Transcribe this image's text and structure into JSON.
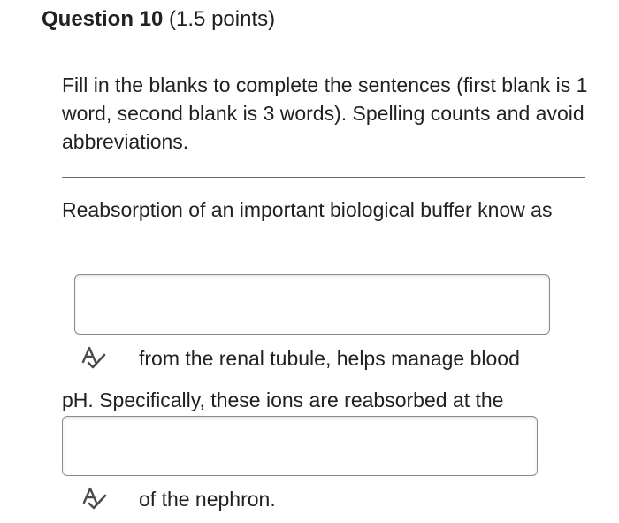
{
  "question": {
    "title": "Question 10",
    "points": "(1.5 points)"
  },
  "instructions": "Fill in the blanks to complete the sentences (first blank is 1 word, second blank is 3 words). Spelling counts and avoid abbreviations.",
  "prompt": "Reabsorption of an important biological buffer know as",
  "blanks": [
    {
      "value": "",
      "placeholder": ""
    },
    {
      "value": "",
      "placeholder": ""
    }
  ],
  "text_after_blank1": "from the renal tubule, helps manage blood",
  "text_before_blank2": "pH. Specifically, these ions are reabsorbed at the",
  "text_after_blank2": "of the nephron.",
  "icons": {
    "spell_check": "spell-check-icon"
  },
  "colors": {
    "text": "#202122",
    "border": "#8a8a8a",
    "icon": "#494c4e"
  }
}
